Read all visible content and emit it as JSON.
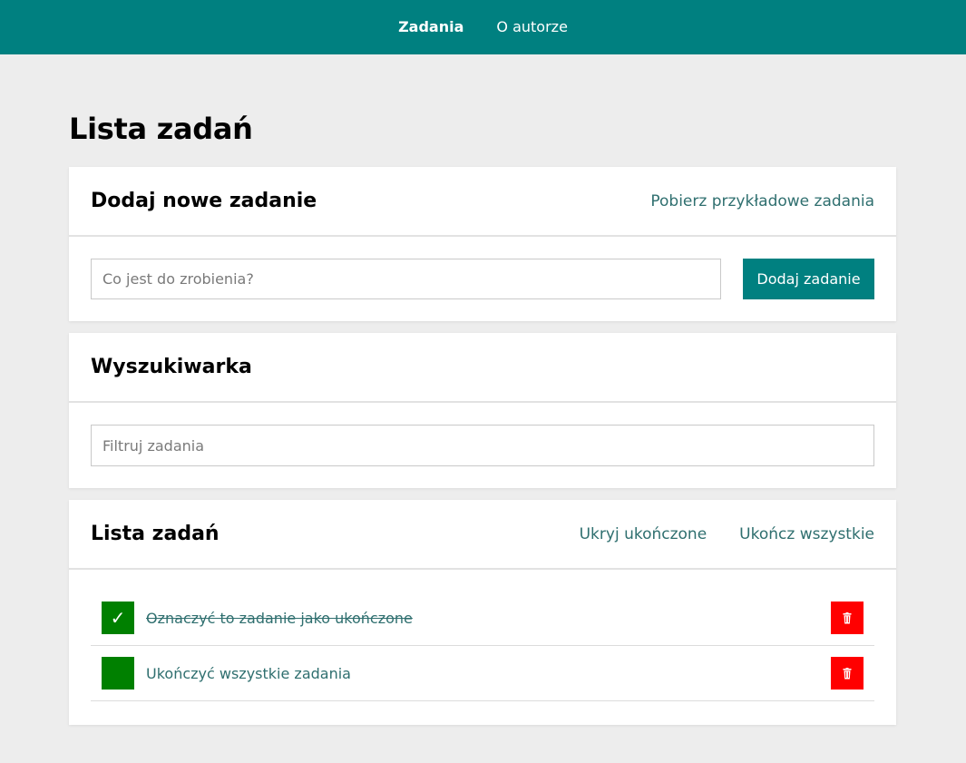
{
  "nav": {
    "items": [
      {
        "label": "Zadania",
        "active": true
      },
      {
        "label": "O autorze",
        "active": false
      }
    ],
    "background": "#008080"
  },
  "page": {
    "title": "Lista zadań"
  },
  "add_card": {
    "title": "Dodaj nowe zadanie",
    "sample_link": "Pobierz przykładowe zadania",
    "input_placeholder": "Co jest do zrobienia?",
    "input_value": "",
    "button_label": "Dodaj zadanie"
  },
  "search_card": {
    "title": "Wyszukiwarka",
    "input_placeholder": "Filtruj zadania",
    "input_value": ""
  },
  "list_card": {
    "title": "Lista zadań",
    "hide_completed_link": "Ukryj ukończone",
    "complete_all_link": "Ukończ wszystkie",
    "tasks": [
      {
        "text": "Oznaczyć to zadanie jako ukończone",
        "completed": true,
        "check_icon": "checkmark-icon",
        "delete_icon": "trash-icon"
      },
      {
        "text": "Ukończyć wszystkie zadania",
        "completed": false,
        "check_icon": "",
        "delete_icon": "trash-icon"
      }
    ]
  },
  "colors": {
    "accent": "#008080",
    "link": "#2f6f6f",
    "checkbox": "#008000",
    "delete": "#ff0000",
    "background": "#ededed"
  }
}
